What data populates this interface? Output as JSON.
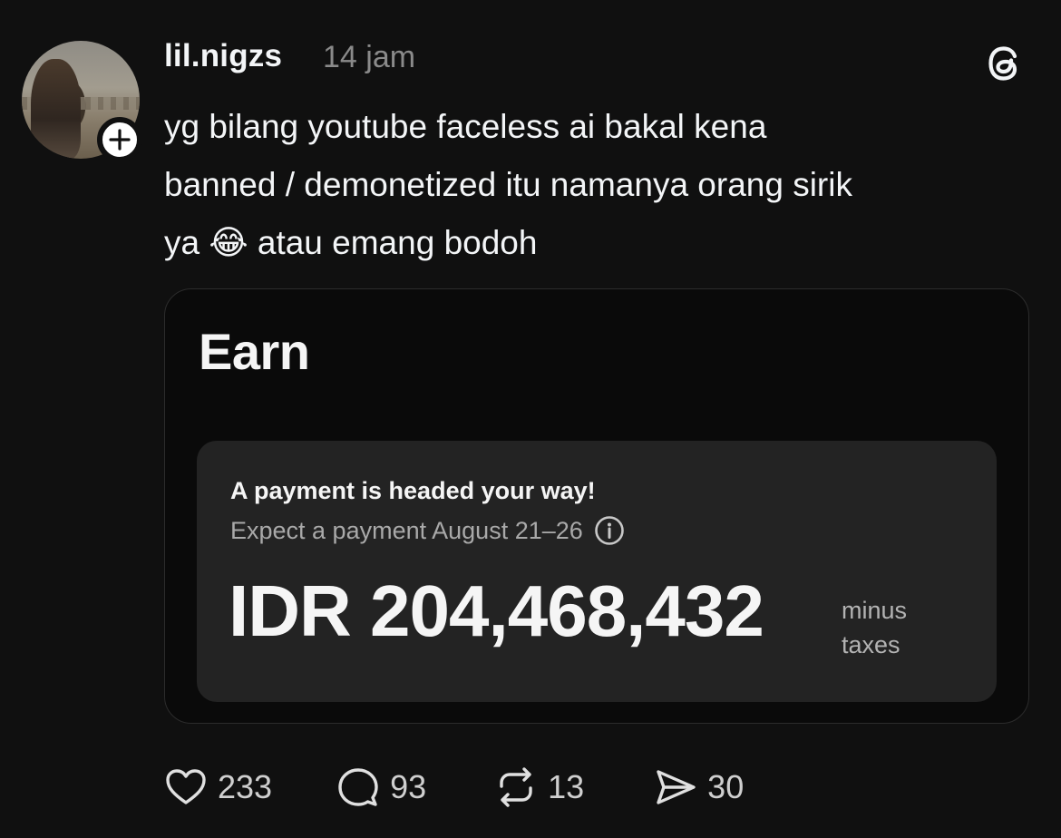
{
  "post": {
    "username": "lil.nigzs",
    "timestamp": "14 jam",
    "text_lines": [
      "yg bilang youtube faceless ai bakal kena",
      "banned / demonetized itu namanya orang sirik",
      "ya 😂 atau emang bodoh"
    ]
  },
  "card": {
    "title": "Earn",
    "headline": "A payment is headed your way!",
    "subline": "Expect a payment August 21–26",
    "amount": "IDR 204,468,432",
    "note_line1": "minus",
    "note_line2": "taxes"
  },
  "actions": {
    "likes": "233",
    "comments": "93",
    "reposts": "13",
    "shares": "30"
  },
  "icons": {
    "avatar": "profile-photo",
    "follow": "plus-icon",
    "brand": "threads-logo-icon",
    "info": "info-icon",
    "like": "heart-icon",
    "comment": "comment-bubble-icon",
    "repost": "repost-icon",
    "share": "send-icon"
  }
}
